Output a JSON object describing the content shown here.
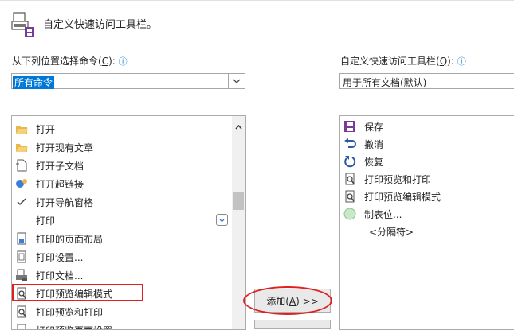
{
  "header": {
    "title": "自定义快速访问工具栏。"
  },
  "left": {
    "label_prefix": "从下列位置选择命令(",
    "label_key": "C",
    "label_suffix": "):",
    "combo_value": "所有命令",
    "items": [
      {
        "label": "打开",
        "icon": "folder-open-icon"
      },
      {
        "label": "打开现有文章",
        "icon": "folder-open-icon"
      },
      {
        "label": "打开子文档",
        "icon": "subdocument-icon"
      },
      {
        "label": "打开超链接",
        "icon": "hyperlink-icon"
      },
      {
        "label": "打开导航窗格",
        "icon": "checkmark-icon"
      },
      {
        "label": "打印",
        "icon": ""
      },
      {
        "label": "打印的页面布局",
        "icon": "page-layout-icon"
      },
      {
        "label": "打印设置...",
        "icon": "print-setup-icon"
      },
      {
        "label": "打印文档...",
        "icon": "print-document-icon"
      },
      {
        "label": "打印预览编辑模式",
        "icon": "print-preview-edit-icon"
      },
      {
        "label": "打印预览和打印",
        "icon": "print-preview-icon"
      },
      {
        "label": "打印预览页面设置",
        "icon": "page-setup-icon"
      }
    ]
  },
  "right": {
    "label_prefix": "自定义快速访问工具栏(",
    "label_key": "Q",
    "label_suffix": "):",
    "combo_value": "用于所有文档(默认)",
    "items": [
      {
        "label": "保存",
        "icon": "save-icon"
      },
      {
        "label": "撤消",
        "icon": "undo-icon"
      },
      {
        "label": "恢复",
        "icon": "redo-icon"
      },
      {
        "label": "打印预览和打印",
        "icon": "print-preview-icon"
      },
      {
        "label": "打印预览编辑模式",
        "icon": "print-preview-edit-icon"
      },
      {
        "label": "制表位...",
        "icon": "tab-stop-icon"
      },
      {
        "label": "<分隔符>",
        "icon": ""
      }
    ]
  },
  "buttons": {
    "add_prefix": "添加(",
    "add_key": "A",
    "add_suffix": ") >>"
  },
  "colors": {
    "accent": "#0078d7",
    "highlight_mark": "#e02020",
    "save_purple": "#7a3a9a"
  }
}
